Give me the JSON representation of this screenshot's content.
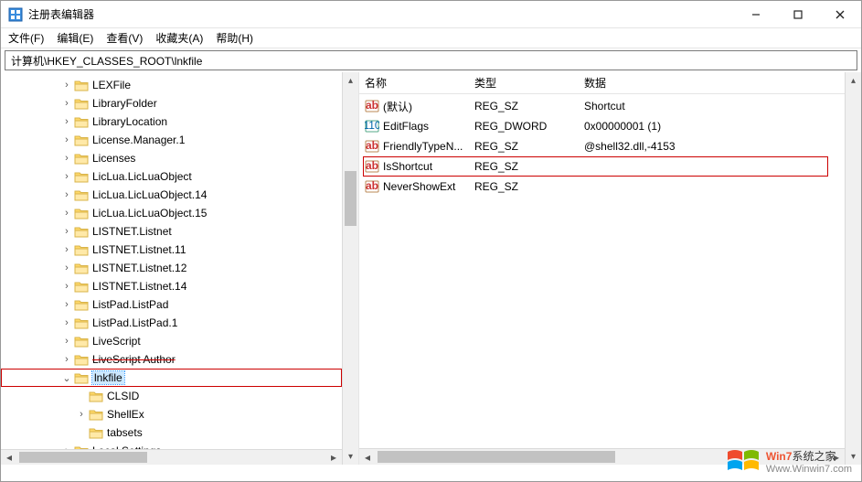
{
  "window": {
    "title": "注册表编辑器"
  },
  "menu": {
    "file": "文件(F)",
    "edit": "编辑(E)",
    "view": "查看(V)",
    "favorites": "收藏夹(A)",
    "help": "帮助(H)"
  },
  "address": "计算机\\HKEY_CLASSES_ROOT\\lnkfile",
  "tree": [
    {
      "indent": 3,
      "exp": ">",
      "label": "LEXFile"
    },
    {
      "indent": 3,
      "exp": ">",
      "label": "LibraryFolder"
    },
    {
      "indent": 3,
      "exp": ">",
      "label": "LibraryLocation"
    },
    {
      "indent": 3,
      "exp": ">",
      "label": "License.Manager.1"
    },
    {
      "indent": 3,
      "exp": ">",
      "label": "Licenses"
    },
    {
      "indent": 3,
      "exp": ">",
      "label": "LicLua.LicLuaObject"
    },
    {
      "indent": 3,
      "exp": ">",
      "label": "LicLua.LicLuaObject.14"
    },
    {
      "indent": 3,
      "exp": ">",
      "label": "LicLua.LicLuaObject.15"
    },
    {
      "indent": 3,
      "exp": ">",
      "label": "LISTNET.Listnet"
    },
    {
      "indent": 3,
      "exp": ">",
      "label": "LISTNET.Listnet.11"
    },
    {
      "indent": 3,
      "exp": ">",
      "label": "LISTNET.Listnet.12"
    },
    {
      "indent": 3,
      "exp": ">",
      "label": "LISTNET.Listnet.14"
    },
    {
      "indent": 3,
      "exp": ">",
      "label": "ListPad.ListPad"
    },
    {
      "indent": 3,
      "exp": ">",
      "label": "ListPad.ListPad.1"
    },
    {
      "indent": 3,
      "exp": ">",
      "label": "LiveScript"
    },
    {
      "indent": 3,
      "exp": ">",
      "label": "LiveScript Author",
      "strike": true
    },
    {
      "indent": 3,
      "exp": "v",
      "label": "lnkfile",
      "selected": true,
      "boxed": true
    },
    {
      "indent": 4,
      "exp": "",
      "label": "CLSID"
    },
    {
      "indent": 4,
      "exp": ">",
      "label": "ShellEx"
    },
    {
      "indent": 4,
      "exp": "",
      "label": "tabsets"
    },
    {
      "indent": 3,
      "exp": ">",
      "label": "Local Settings"
    }
  ],
  "columns": {
    "name": "名称",
    "type": "类型",
    "data": "数据"
  },
  "values": [
    {
      "icon": "sz",
      "name": "(默认)",
      "type": "REG_SZ",
      "data": "Shortcut"
    },
    {
      "icon": "bin",
      "name": "EditFlags",
      "type": "REG_DWORD",
      "data": "0x00000001 (1)"
    },
    {
      "icon": "sz",
      "name": "FriendlyTypeN...",
      "type": "REG_SZ",
      "data": "@shell32.dll,-4153"
    },
    {
      "icon": "sz",
      "name": "IsShortcut",
      "type": "REG_SZ",
      "data": "",
      "boxed": true
    },
    {
      "icon": "sz",
      "name": "NeverShowExt",
      "type": "REG_SZ",
      "data": ""
    }
  ],
  "watermark": {
    "line1_prefix": "Win7",
    "line1_suffix": "系统之家",
    "line2": "Www.Winwin7.com"
  }
}
